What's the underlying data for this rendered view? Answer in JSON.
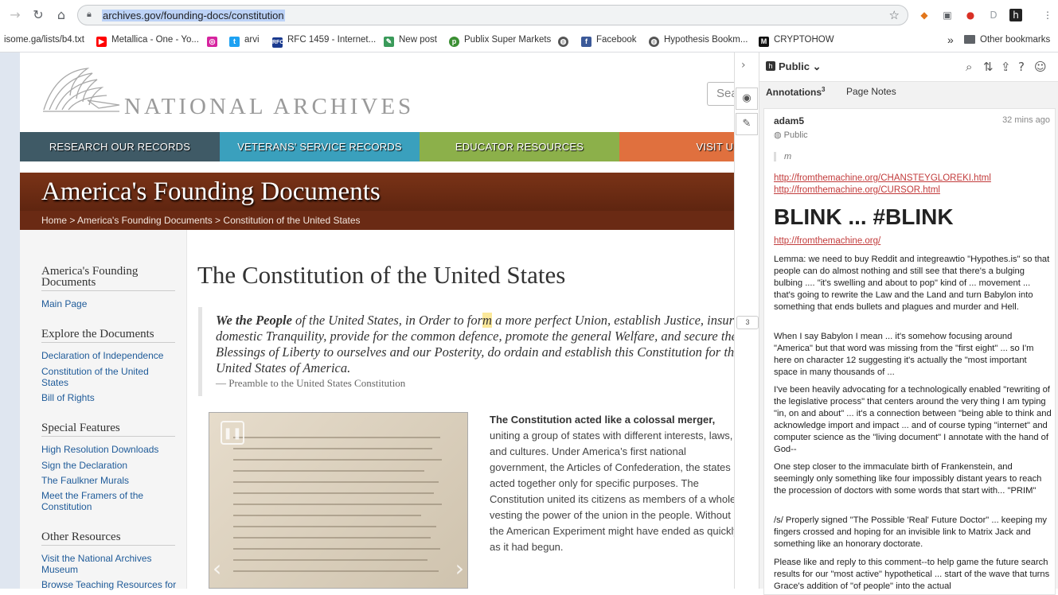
{
  "browser": {
    "url": "archives.gov/founding-docs/constitution",
    "bookmarks": [
      {
        "label": "isome.ga/lists/b4.txt",
        "icon": "none"
      },
      {
        "label": "Metallica - One - Yo...",
        "icon": "youtube-icon",
        "color": "#ff0000"
      },
      {
        "label": "",
        "icon": "instagram-icon",
        "color": "#d6249f"
      },
      {
        "label": "arvi",
        "icon": "twitter-icon",
        "color": "#1da1f2"
      },
      {
        "label": "RFC 1459 - Internet...",
        "icon": "rfc-icon",
        "color": "#1a3a8f"
      },
      {
        "label": "New post",
        "icon": "post-icon",
        "color": "#3a9a5a"
      },
      {
        "label": "Publix Super Markets",
        "icon": "publix-icon",
        "color": "#3b8f33"
      },
      {
        "label": "",
        "icon": "globe-icon",
        "color": "#555555"
      },
      {
        "label": "Facebook",
        "icon": "facebook-icon",
        "color": "#3b5998"
      },
      {
        "label": "Hypothesis Bookm...",
        "icon": "globe-icon",
        "color": "#555555"
      },
      {
        "label": "CRYPTOHOW",
        "icon": "cryptohow-icon",
        "color": "#111111"
      }
    ],
    "overflow_label": "»",
    "other_bookmarks": "Other bookmarks"
  },
  "site": {
    "logo_text": "NATIONAL ARCHIVES",
    "search_placeholder": "Sea",
    "nav": [
      {
        "label": "RESEARCH OUR RECORDS",
        "color": "#3f5a66"
      },
      {
        "label": "VETERANS' SERVICE RECORDS",
        "color": "#3aa0bd"
      },
      {
        "label": "EDUCATOR RESOURCES",
        "color": "#8cb04a"
      },
      {
        "label": "VISIT US",
        "color": "#e0703e"
      }
    ],
    "banner_title": "America's Founding Documents",
    "breadcrumb": "Home > America's Founding Documents > Constitution of the United States"
  },
  "sidebar": {
    "sections": [
      {
        "heading": "America's Founding Documents",
        "links": [
          "Main Page"
        ]
      },
      {
        "heading": "Explore the Documents",
        "links": [
          "Declaration of Independence",
          "Constitution of the United States",
          "Bill of Rights"
        ]
      },
      {
        "heading": "Special Features",
        "links": [
          "High Resolution Downloads",
          "Sign the Declaration",
          "The Faulkner Murals",
          "Meet the Framers of the Constitution"
        ]
      },
      {
        "heading": "Other Resources",
        "links": [
          "Visit the National Archives Museum",
          "Browse Teaching Resources for"
        ]
      }
    ]
  },
  "main": {
    "title": "The Constitution of the United States",
    "quote_lead": "We the People",
    "quote_part1": " of the United States, in Order to for",
    "quote_highlight": "m",
    "quote_part2": " a more perfect Union, establish Justice, insure domestic Tranquility, provide for the common defence, promote the general Welfare, and secure the Blessings of Liberty to ourselves and our Posterity, do ordain and establish this Constitution for the United States of America.",
    "quote_attribution": "— Preamble to the United States Constitution",
    "body_lead": "The Constitution acted like a colossal merger,",
    "body_rest": " uniting a group of states with different interests, laws, and cultures. Under America’s first national  government, the Articles of Confederation, the states acted together only for specific purposes. The Constitution united its citizens as members of a whole, vesting the power of the union in the people. Without it, the American Experiment might have ended as quickly as it had begun.",
    "annotation_count": "3"
  },
  "hypothesis": {
    "group": "Public",
    "tabs": {
      "annotations": "Annotations",
      "annotations_count": "3",
      "page_notes": "Page Notes"
    },
    "annotation": {
      "user": "adam5",
      "timestamp": "32 mins ago",
      "scope": "Public",
      "quote": "m",
      "links": [
        "http://fromthemachine.org/CHANSTEYGLOREKI.html",
        "http://fromthemachine.org/CURSOR.html"
      ],
      "heading": "BLINK ... #BLINK",
      "link2": "http://fromthemachine.org/",
      "paragraphs": [
        "Lemma: we need to buy Reddit and integreawtio \"Hypothes.is\" so that people can do almost nothing and still see that there's a bulging bulbing .... \"it's swelling and about to pop\" kind of ... movement ... that's going to rewrite the Law and the Land and turn Babylon into something that ends bullets and plagues and murder and Hell.",
        "When I say Babylon I mean ... it's somehow focusing around \"America\" but that word was missing from the \"first eight\" ... so I'm here on character 12 suggesting it's actually the \"most important space in many thousands of ...",
        "I've been heavily advocating for a technologically enabled \"rewriting of the legislative process\" that centers around the very thing I am typing \"in, on and about\" ... it's a connection between \"being able to think and acknowledge import and impact ... and of course typing \"internet\" and computer science as the \"living document\" I annotate with the hand of God--",
        "One step closer to the immaculate birth of Frankenstein, and seemingly only something like four impossibly distant years to reach the procession of doctors with some words that start with... \"PRIM\"",
        "/s/ Properly signed \"The Possible 'Real' Future Doctor\" ... keeping my fingers crossed and hoping for an invisible link to Matrix Jack and something like an honorary doctorate.",
        "Please like and reply to this comment--to help game the future search results for our \"most active\" hypothetical ... start of the wave that turns Grace's addition of \"of people\" into the actual"
      ]
    }
  }
}
